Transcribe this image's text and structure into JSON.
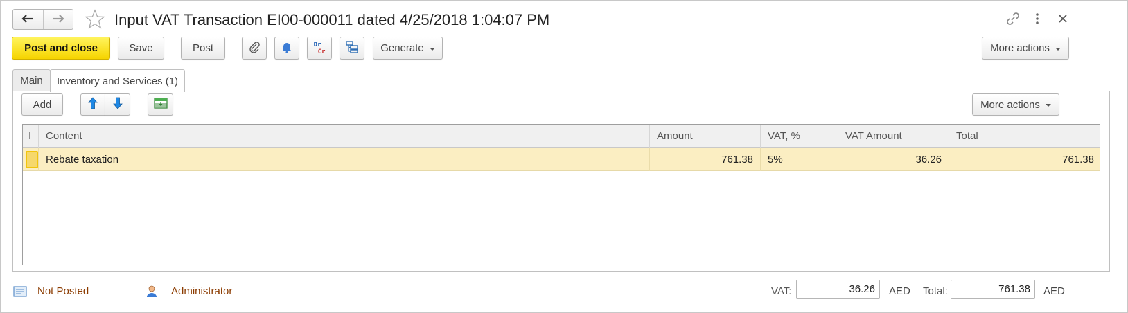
{
  "window": {
    "title": "Input VAT Transaction EI00-000011 dated 4/25/2018 1:04:07 PM",
    "back_icon": "arrow-left-icon",
    "forward_icon": "arrow-right-icon",
    "favorite_icon": "star-outline-icon",
    "link_icon": "link-icon",
    "menu_icon": "vertical-dots-icon",
    "close_icon": "close-icon"
  },
  "toolbar": {
    "post_and_close": "Post and close",
    "save": "Save",
    "post": "Post",
    "attach_icon": "paperclip-icon",
    "reminder_icon": "bell-icon",
    "dr_label": "Dr",
    "cr_label": "Cr",
    "structure_icon": "structure-icon",
    "generate": "Generate",
    "more_actions": "More actions"
  },
  "tabs": [
    {
      "label": "Main",
      "active": false
    },
    {
      "label": "Inventory and Services (1)",
      "active": true
    }
  ],
  "table_toolbar": {
    "add": "Add",
    "move_up_icon": "arrow-up-icon",
    "move_down_icon": "arrow-down-icon",
    "fill_icon": "fill-table-icon",
    "more_actions": "More actions"
  },
  "table": {
    "columns": [
      "I",
      "Content",
      "Amount",
      "VAT, %",
      "VAT Amount",
      "Total"
    ],
    "rows": [
      {
        "content": "Rebate taxation",
        "amount": "761.38",
        "vat_rate": "5%",
        "vat_amount": "36.26",
        "total": "761.38"
      }
    ]
  },
  "footer": {
    "status": "Not Posted",
    "author": "Administrator",
    "vat_label": "VAT:",
    "vat_value": "36.26",
    "vat_currency": "AED",
    "total_label": "Total:",
    "total_value": "761.38",
    "total_currency": "AED"
  },
  "colors": {
    "primary_button": "#f6d400",
    "selected_row": "#fbeec2",
    "status_link": "#8b3b00",
    "arrow_blue": "#1e88e5"
  }
}
